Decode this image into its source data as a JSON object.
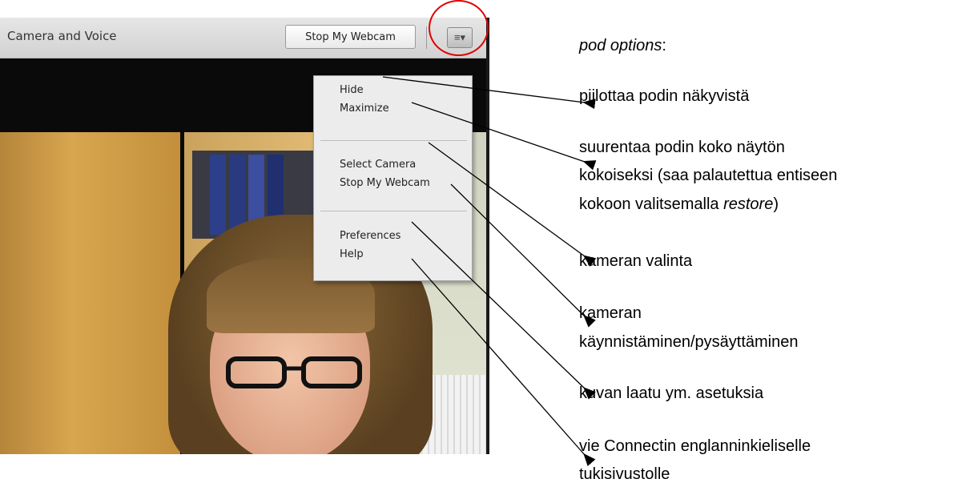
{
  "pod": {
    "title": "Camera and Voice",
    "stop_webcam_button": "Stop My Webcam",
    "menu_icon": "pod-options-menu-icon"
  },
  "menu": {
    "items": [
      "Hide",
      "Maximize",
      "Select Camera",
      "Stop My Webcam",
      "Preferences",
      "Help"
    ]
  },
  "annotations": {
    "heading_italic": "pod options",
    "heading_suffix": ":",
    "notes": [
      "piilottaa podin näkyvistä",
      "suurentaa podin koko näytön",
      "kokoiseksi (saa palautettua entiseen",
      "kokoon valitsemalla ",
      "restore",
      ")",
      "kameran valinta",
      "kameran",
      "käynnistäminen/pysäyttäminen",
      "kuvan laatu ym. asetuksia",
      "vie Connectin englanninkieliselle",
      "tukisivustolle"
    ]
  },
  "colors": {
    "highlight_ring": "#e00000"
  }
}
